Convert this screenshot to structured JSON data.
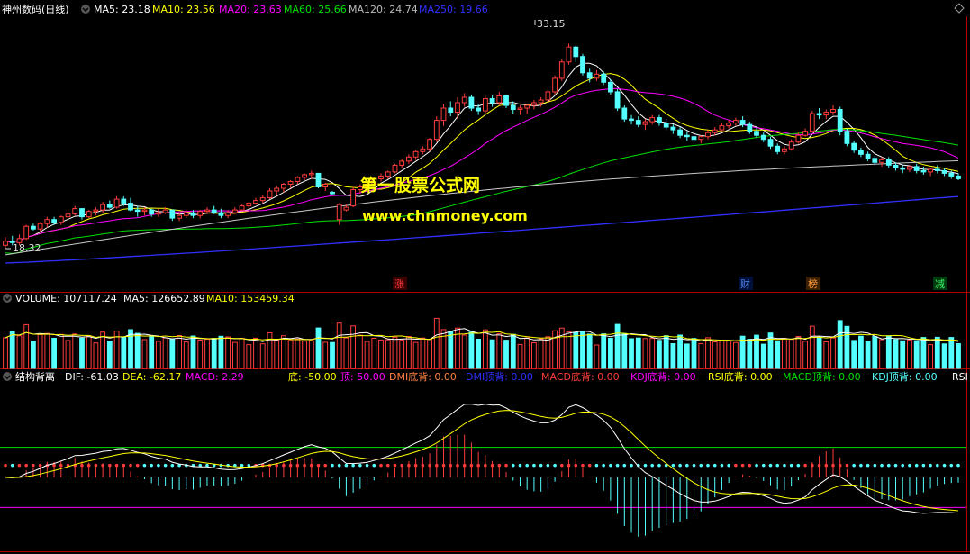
{
  "colors": {
    "background": "#000000",
    "frame": "#b30000",
    "up": "#ff3c3c",
    "down": "#54ffff",
    "white": "#ffffff",
    "yellow": "#ffff00",
    "magenta": "#ff00ff",
    "green": "#00e000",
    "blue": "#3030ff",
    "orange": "#ff8040"
  },
  "header": {
    "title": "神州数码(日线)",
    "ma5_label": "MA5: 23.18",
    "ma10_label": "MA10: 23.56",
    "ma20_label": "MA20: 23.63",
    "ma60_label": "MA60: 25.66",
    "ma120_label": "MA120: 24.74",
    "ma250_label": "MA250: 19.66"
  },
  "watermark": {
    "line1": "第一股票公式网",
    "line2": "www.chnmoney.com"
  },
  "event_markers": [
    "涨",
    "财",
    "榜",
    "减"
  ],
  "volume_header": {
    "volume_label": "VOLUME: 107117.24",
    "ma5_label": "MA5: 126652.89",
    "ma10_label": "MA10: 153459.34"
  },
  "indicator_header": {
    "name": "结构背离",
    "dif_label": "DIF: -61.03",
    "dea_label": "DEA: -62.17",
    "macd_label": "MACD: 2.29",
    "di_label": "底: -50.00",
    "ding_label": "顶: 50.00",
    "dmi_bottom_label": "DMI底背: 0.00",
    "dmi_top_label": "DMI顶背: 0.00",
    "macd_bottom_label": "MACD底背: 0.00",
    "kdj_bottom_label": "KDJ底背: 0.00",
    "rsi_bottom_label": "RSI底背: 0.00",
    "macd_top_label": "MACD顶背: 0.00",
    "kdj_top_label": "KDJ顶背: 0.00",
    "rsi_cut_label": "RSI"
  },
  "chart_data": {
    "type": "candlestick",
    "y_axis_range": [
      16.6,
      34.9
    ],
    "annotations": {
      "high_label": "33.15",
      "low_label": "18.32"
    },
    "candles": [
      [
        18.9,
        18.1,
        18.3,
        18.6
      ],
      [
        19.0,
        18.3,
        18.6,
        18.5
      ],
      [
        19.1,
        18.3,
        18.5,
        18.8
      ],
      [
        19.8,
        18.7,
        18.8,
        19.7
      ],
      [
        19.9,
        19.4,
        19.7,
        19.5
      ],
      [
        20.0,
        19.3,
        19.5,
        19.9
      ],
      [
        20.4,
        19.6,
        19.9,
        20.2
      ],
      [
        20.4,
        19.8,
        20.2,
        20.0
      ],
      [
        20.5,
        19.8,
        20.0,
        20.4
      ],
      [
        20.8,
        20.2,
        20.4,
        20.6
      ],
      [
        21.2,
        20.5,
        20.6,
        21.0
      ],
      [
        21.0,
        20.2,
        21.0,
        20.4
      ],
      [
        20.9,
        20.3,
        20.4,
        20.8
      ],
      [
        21.1,
        20.5,
        20.8,
        20.9
      ],
      [
        21.5,
        20.7,
        20.9,
        21.3
      ],
      [
        21.6,
        21.0,
        21.3,
        21.1
      ],
      [
        21.9,
        21.0,
        21.1,
        21.7
      ],
      [
        21.9,
        21.2,
        21.7,
        21.4
      ],
      [
        21.8,
        20.8,
        21.4,
        20.9
      ],
      [
        21.2,
        20.4,
        20.9,
        20.8
      ],
      [
        21.1,
        20.5,
        20.8,
        20.9
      ],
      [
        21.0,
        20.4,
        20.9,
        20.6
      ],
      [
        21.0,
        20.4,
        20.6,
        20.7
      ],
      [
        21.1,
        20.6,
        20.7,
        20.9
      ],
      [
        20.9,
        20.1,
        20.9,
        20.3
      ],
      [
        20.7,
        20.1,
        20.3,
        20.5
      ],
      [
        20.9,
        20.3,
        20.5,
        20.7
      ],
      [
        20.9,
        20.3,
        20.7,
        20.5
      ],
      [
        20.9,
        20.3,
        20.5,
        20.8
      ],
      [
        21.1,
        20.6,
        20.8,
        20.9
      ],
      [
        21.2,
        20.6,
        20.9,
        20.7
      ],
      [
        21.0,
        20.3,
        20.7,
        20.5
      ],
      [
        20.9,
        20.3,
        20.5,
        20.7
      ],
      [
        21.1,
        20.6,
        20.7,
        20.9
      ],
      [
        21.3,
        20.8,
        20.9,
        21.2
      ],
      [
        21.5,
        21.0,
        21.2,
        21.4
      ],
      [
        21.8,
        21.3,
        21.4,
        21.6
      ],
      [
        22.0,
        21.4,
        21.6,
        21.8
      ],
      [
        22.5,
        21.7,
        21.8,
        22.3
      ],
      [
        22.7,
        22.0,
        22.3,
        22.5
      ],
      [
        22.9,
        22.2,
        22.5,
        22.8
      ],
      [
        23.1,
        22.5,
        22.8,
        23.0
      ],
      [
        23.4,
        22.8,
        23.0,
        23.3
      ],
      [
        23.6,
        23.1,
        23.3,
        23.5
      ],
      [
        23.8,
        23.2,
        23.5,
        23.6
      ],
      [
        23.6,
        22.5,
        23.6,
        22.6
      ],
      [
        22.9,
        22.3,
        22.6,
        22.8
      ],
      [
        22.3,
        22.0,
        22.2,
        22.1
      ],
      [
        21.4,
        19.8,
        20.2,
        21.3
      ],
      [
        21.3,
        20.8,
        20.9,
        21.1
      ],
      [
        22.6,
        21.1,
        21.2,
        22.4
      ],
      [
        22.8,
        22.1,
        22.4,
        22.6
      ],
      [
        23.0,
        22.4,
        22.6,
        22.8
      ],
      [
        23.3,
        22.7,
        22.8,
        23.2
      ],
      [
        23.6,
        23.0,
        23.2,
        23.4
      ],
      [
        23.8,
        23.2,
        23.4,
        23.7
      ],
      [
        24.3,
        23.6,
        23.7,
        24.2
      ],
      [
        24.7,
        24.0,
        24.2,
        24.5
      ],
      [
        25.0,
        24.3,
        24.5,
        24.8
      ],
      [
        25.3,
        24.6,
        24.8,
        25.2
      ],
      [
        25.6,
        25.0,
        25.2,
        25.4
      ],
      [
        26.2,
        25.2,
        25.4,
        26.1
      ],
      [
        27.8,
        25.9,
        26.1,
        27.5
      ],
      [
        28.7,
        27.1,
        27.5,
        28.4
      ],
      [
        28.9,
        27.8,
        28.4,
        28.1
      ],
      [
        29.2,
        27.6,
        28.1,
        28.8
      ],
      [
        29.5,
        28.5,
        28.8,
        29.2
      ],
      [
        29.4,
        28.2,
        29.2,
        28.4
      ],
      [
        28.7,
        27.9,
        28.4,
        28.2
      ],
      [
        29.3,
        28.0,
        28.2,
        29.1
      ],
      [
        29.4,
        28.5,
        29.1,
        28.8
      ],
      [
        29.6,
        28.6,
        28.8,
        29.3
      ],
      [
        29.4,
        28.4,
        29.3,
        28.6
      ],
      [
        28.9,
        28.0,
        28.6,
        28.3
      ],
      [
        28.6,
        27.9,
        28.3,
        28.4
      ],
      [
        28.7,
        28.0,
        28.4,
        28.6
      ],
      [
        29.0,
        28.3,
        28.6,
        28.8
      ],
      [
        29.2,
        28.5,
        28.8,
        29.0
      ],
      [
        29.8,
        28.8,
        29.0,
        29.6
      ],
      [
        30.8,
        29.4,
        29.6,
        30.6
      ],
      [
        32.0,
        30.4,
        30.6,
        31.8
      ],
      [
        33.15,
        31.6,
        31.8,
        32.9
      ],
      [
        33.0,
        31.8,
        32.9,
        32.2
      ],
      [
        32.4,
        30.8,
        32.2,
        31.0
      ],
      [
        31.3,
        30.3,
        31.0,
        30.6
      ],
      [
        31.2,
        30.4,
        30.6,
        30.9
      ],
      [
        31.1,
        30.1,
        30.9,
        30.3
      ],
      [
        30.5,
        29.4,
        30.3,
        29.6
      ],
      [
        29.8,
        28.2,
        29.6,
        28.4
      ],
      [
        28.6,
        27.4,
        28.4,
        27.6
      ],
      [
        27.9,
        27.2,
        27.6,
        27.5
      ],
      [
        27.8,
        27.0,
        27.5,
        27.2
      ],
      [
        27.6,
        26.8,
        27.2,
        27.4
      ],
      [
        27.9,
        27.2,
        27.4,
        27.7
      ],
      [
        27.9,
        27.1,
        27.7,
        27.3
      ],
      [
        27.6,
        26.8,
        27.3,
        27.0
      ],
      [
        27.2,
        26.5,
        27.0,
        26.8
      ],
      [
        27.0,
        26.2,
        26.8,
        26.4
      ],
      [
        26.7,
        26.0,
        26.4,
        26.3
      ],
      [
        26.5,
        25.9,
        26.3,
        26.1
      ],
      [
        26.4,
        25.8,
        26.1,
        26.3
      ],
      [
        26.8,
        26.1,
        26.3,
        26.6
      ],
      [
        27.0,
        26.4,
        26.6,
        26.8
      ],
      [
        27.3,
        26.7,
        26.8,
        27.1
      ],
      [
        27.5,
        26.9,
        27.1,
        27.3
      ],
      [
        27.7,
        27.1,
        27.3,
        27.5
      ],
      [
        27.8,
        27.0,
        27.5,
        27.2
      ],
      [
        27.4,
        26.5,
        27.2,
        26.7
      ],
      [
        27.0,
        26.2,
        26.7,
        26.4
      ],
      [
        26.6,
        25.9,
        26.4,
        26.1
      ],
      [
        26.3,
        25.4,
        26.1,
        25.6
      ],
      [
        25.8,
        25.0,
        25.6,
        25.2
      ],
      [
        25.6,
        25.0,
        25.2,
        25.4
      ],
      [
        26.1,
        25.3,
        25.4,
        25.9
      ],
      [
        26.6,
        25.8,
        25.9,
        26.4
      ],
      [
        26.9,
        26.3,
        26.4,
        26.7
      ],
      [
        28.2,
        26.6,
        26.7,
        28.0
      ],
      [
        28.4,
        27.6,
        28.0,
        27.9
      ],
      [
        28.3,
        27.6,
        27.9,
        28.1
      ],
      [
        28.6,
        27.9,
        28.1,
        28.3
      ],
      [
        28.5,
        26.4,
        28.3,
        26.7
      ],
      [
        26.9,
        25.6,
        26.7,
        25.8
      ],
      [
        26.0,
        25.1,
        25.8,
        25.3
      ],
      [
        25.5,
        24.8,
        25.3,
        25.0
      ],
      [
        25.2,
        24.5,
        25.0,
        24.7
      ],
      [
        24.9,
        24.2,
        24.7,
        24.4
      ],
      [
        24.8,
        24.1,
        24.4,
        24.6
      ],
      [
        24.8,
        24.0,
        24.6,
        24.2
      ],
      [
        24.4,
        23.8,
        24.2,
        24.0
      ],
      [
        24.2,
        23.6,
        24.0,
        23.9
      ],
      [
        24.2,
        23.7,
        23.9,
        24.1
      ],
      [
        24.3,
        23.6,
        24.1,
        23.8
      ],
      [
        24.1,
        23.5,
        23.8,
        23.7
      ],
      [
        24.0,
        23.4,
        23.7,
        23.9
      ],
      [
        24.2,
        23.6,
        23.9,
        23.8
      ],
      [
        24.0,
        23.4,
        23.8,
        23.6
      ],
      [
        23.8,
        23.2,
        23.6,
        23.4
      ],
      [
        23.6,
        23.1,
        23.4,
        23.2
      ]
    ],
    "volume_series": {
      "type": "bar",
      "y_axis_range": [
        0,
        460000
      ]
    },
    "macd_series": {
      "type": "line+histogram",
      "y_axis_range": [
        -120,
        150
      ],
      "lines": [
        "DIF",
        "DEA"
      ]
    }
  }
}
